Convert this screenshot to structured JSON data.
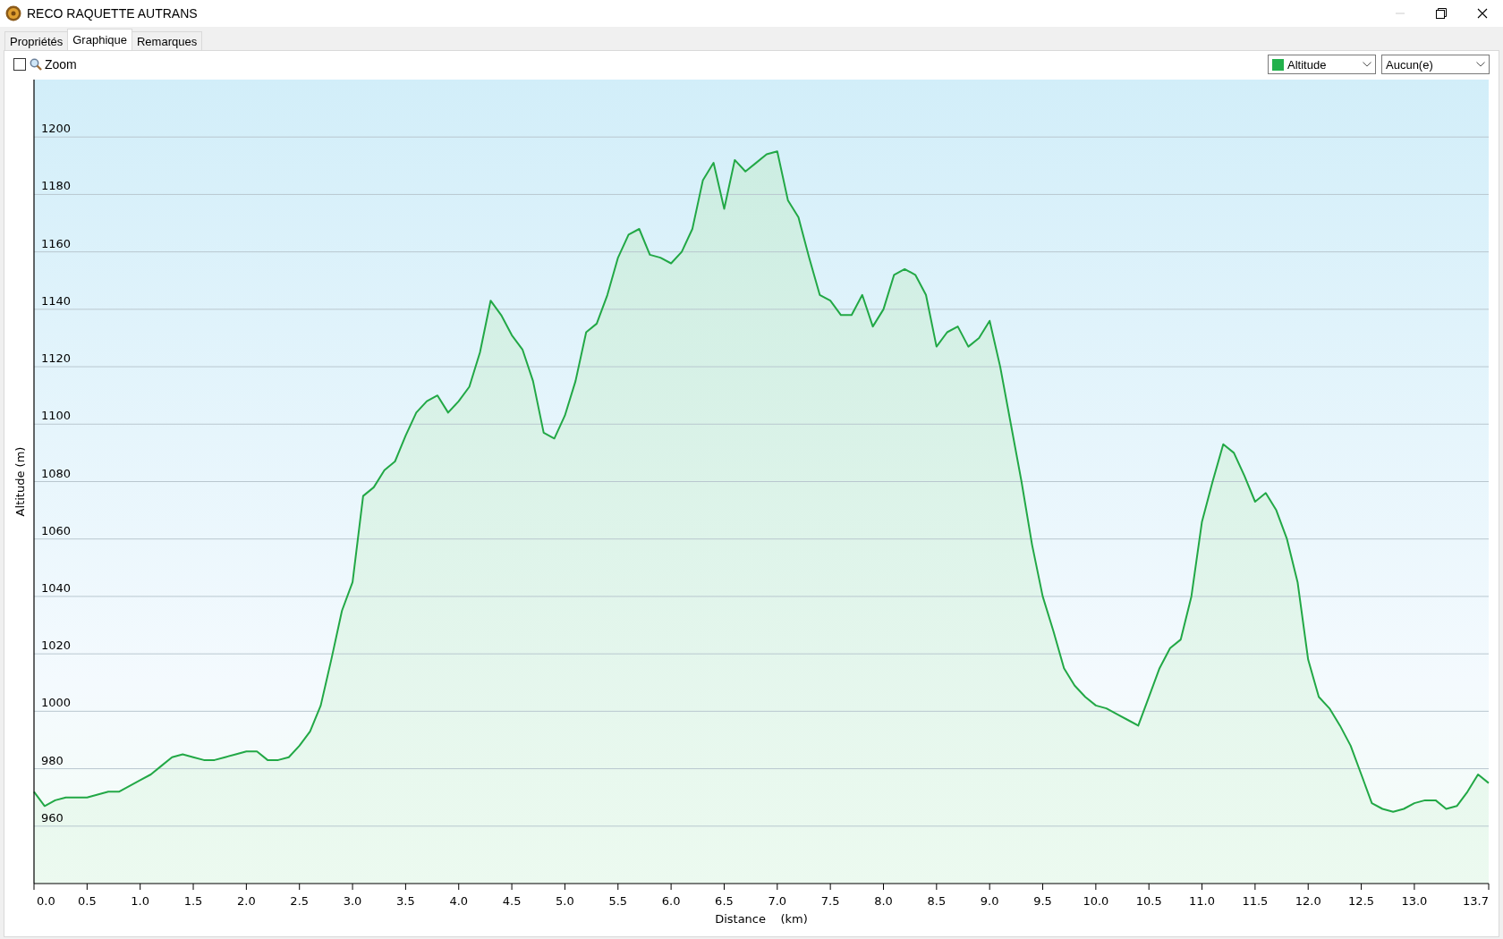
{
  "window": {
    "title": "RECO RAQUETTE AUTRANS"
  },
  "tabs": [
    {
      "label": "Propriétés",
      "selected": false
    },
    {
      "label": "Graphique",
      "selected": true
    },
    {
      "label": "Remarques",
      "selected": false
    }
  ],
  "toolbar": {
    "zoom": {
      "label": "Zoom",
      "checked": false
    },
    "series_select": {
      "value": "Altitude",
      "color": "#22b14c"
    },
    "second_select": {
      "value": "Aucun(e)"
    }
  },
  "chart": {
    "chart_data": {
      "type": "area",
      "grid": true,
      "xlabel": "Distance    (km)",
      "ylabel": "Altitude (m)",
      "xlim": [
        0,
        13.7
      ],
      "ylim": [
        940,
        1220
      ],
      "xticks": [
        {
          "value": 0,
          "label": "0.0"
        },
        {
          "value": 0.5,
          "label": "0.5"
        },
        {
          "value": 1,
          "label": "1.0"
        },
        {
          "value": 1.5,
          "label": "1.5"
        },
        {
          "value": 2,
          "label": "2.0"
        },
        {
          "value": 2.5,
          "label": "2.5"
        },
        {
          "value": 3,
          "label": "3.0"
        },
        {
          "value": 3.5,
          "label": "3.5"
        },
        {
          "value": 4,
          "label": "4.0"
        },
        {
          "value": 4.5,
          "label": "4.5"
        },
        {
          "value": 5,
          "label": "5.0"
        },
        {
          "value": 5.5,
          "label": "5.5"
        },
        {
          "value": 6,
          "label": "6.0"
        },
        {
          "value": 6.5,
          "label": "6.5"
        },
        {
          "value": 7,
          "label": "7.0"
        },
        {
          "value": 7.5,
          "label": "7.5"
        },
        {
          "value": 8,
          "label": "8.0"
        },
        {
          "value": 8.5,
          "label": "8.5"
        },
        {
          "value": 9,
          "label": "9.0"
        },
        {
          "value": 9.5,
          "label": "9.5"
        },
        {
          "value": 10,
          "label": "10.0"
        },
        {
          "value": 10.5,
          "label": "10.5"
        },
        {
          "value": 11,
          "label": "11.0"
        },
        {
          "value": 11.5,
          "label": "11.5"
        },
        {
          "value": 12,
          "label": "12.0"
        },
        {
          "value": 12.5,
          "label": "12.5"
        },
        {
          "value": 13,
          "label": "13.0"
        },
        {
          "value": 13.7,
          "label": "13.7"
        }
      ],
      "yticks": [
        960,
        980,
        1000,
        1020,
        1040,
        1060,
        1080,
        1100,
        1120,
        1140,
        1160,
        1180,
        1200
      ],
      "x": [
        0,
        0.1,
        0.2,
        0.3,
        0.4,
        0.5,
        0.6,
        0.7,
        0.8,
        0.9,
        1,
        1.1,
        1.2,
        1.3,
        1.4,
        1.5,
        1.6,
        1.7,
        1.8,
        1.9,
        2,
        2.1,
        2.2,
        2.3,
        2.4,
        2.5,
        2.6,
        2.7,
        2.8,
        2.9,
        3,
        3.1,
        3.2,
        3.3,
        3.4,
        3.5,
        3.6,
        3.7,
        3.8,
        3.9,
        4,
        4.1,
        4.2,
        4.3,
        4.4,
        4.5,
        4.6,
        4.7,
        4.8,
        4.9,
        5,
        5.1,
        5.2,
        5.3,
        5.4,
        5.5,
        5.6,
        5.7,
        5.8,
        5.9,
        6,
        6.1,
        6.2,
        6.3,
        6.4,
        6.5,
        6.6,
        6.7,
        6.8,
        6.9,
        7,
        7.1,
        7.2,
        7.3,
        7.4,
        7.5,
        7.6,
        7.7,
        7.8,
        7.9,
        8,
        8.1,
        8.2,
        8.3,
        8.4,
        8.5,
        8.6,
        8.7,
        8.8,
        8.9,
        9,
        9.1,
        9.2,
        9.3,
        9.4,
        9.5,
        9.6,
        9.7,
        9.8,
        9.9,
        10,
        10.1,
        10.2,
        10.3,
        10.4,
        10.5,
        10.6,
        10.7,
        10.8,
        10.9,
        11,
        11.1,
        11.2,
        11.3,
        11.4,
        11.5,
        11.6,
        11.7,
        11.8,
        11.9,
        12,
        12.1,
        12.2,
        12.3,
        12.4,
        12.5,
        12.6,
        12.7,
        12.8,
        12.9,
        13,
        13.1,
        13.2,
        13.3,
        13.4,
        13.5,
        13.6,
        13.7
      ],
      "series": [
        {
          "color": "#22a846",
          "values": [
            972,
            967,
            969,
            970,
            970,
            970,
            971,
            972,
            972,
            974,
            976,
            978,
            981,
            984,
            985,
            984,
            983,
            983,
            984,
            985,
            986,
            986,
            983,
            983,
            984,
            988,
            993,
            1002,
            1018,
            1035,
            1045,
            1075,
            1078,
            1084,
            1087,
            1096,
            1104,
            1108,
            1110,
            1104,
            1108,
            1113,
            1125,
            1143,
            1138,
            1131,
            1126,
            1115,
            1097,
            1095,
            1103,
            1115,
            1132,
            1135,
            1145,
            1158,
            1166,
            1168,
            1159,
            1158,
            1156,
            1160,
            1168,
            1185,
            1191,
            1175,
            1192,
            1188,
            1191,
            1194,
            1195,
            1178,
            1172,
            1158,
            1145,
            1143,
            1138,
            1138,
            1145,
            1134,
            1140,
            1152,
            1154,
            1152,
            1145,
            1127,
            1132,
            1134,
            1127,
            1130,
            1136,
            1120,
            1100,
            1080,
            1058,
            1040,
            1028,
            1015,
            1009,
            1005,
            1002,
            1001,
            999,
            997,
            995,
            1005,
            1015,
            1022,
            1025,
            1040,
            1066,
            1080,
            1093,
            1090,
            1082,
            1073,
            1076,
            1070,
            1060,
            1045,
            1018,
            1005,
            1001,
            995,
            988,
            978,
            968,
            966,
            965,
            966,
            968,
            969,
            969,
            966,
            967,
            972,
            978,
            975
          ]
        }
      ]
    }
  }
}
